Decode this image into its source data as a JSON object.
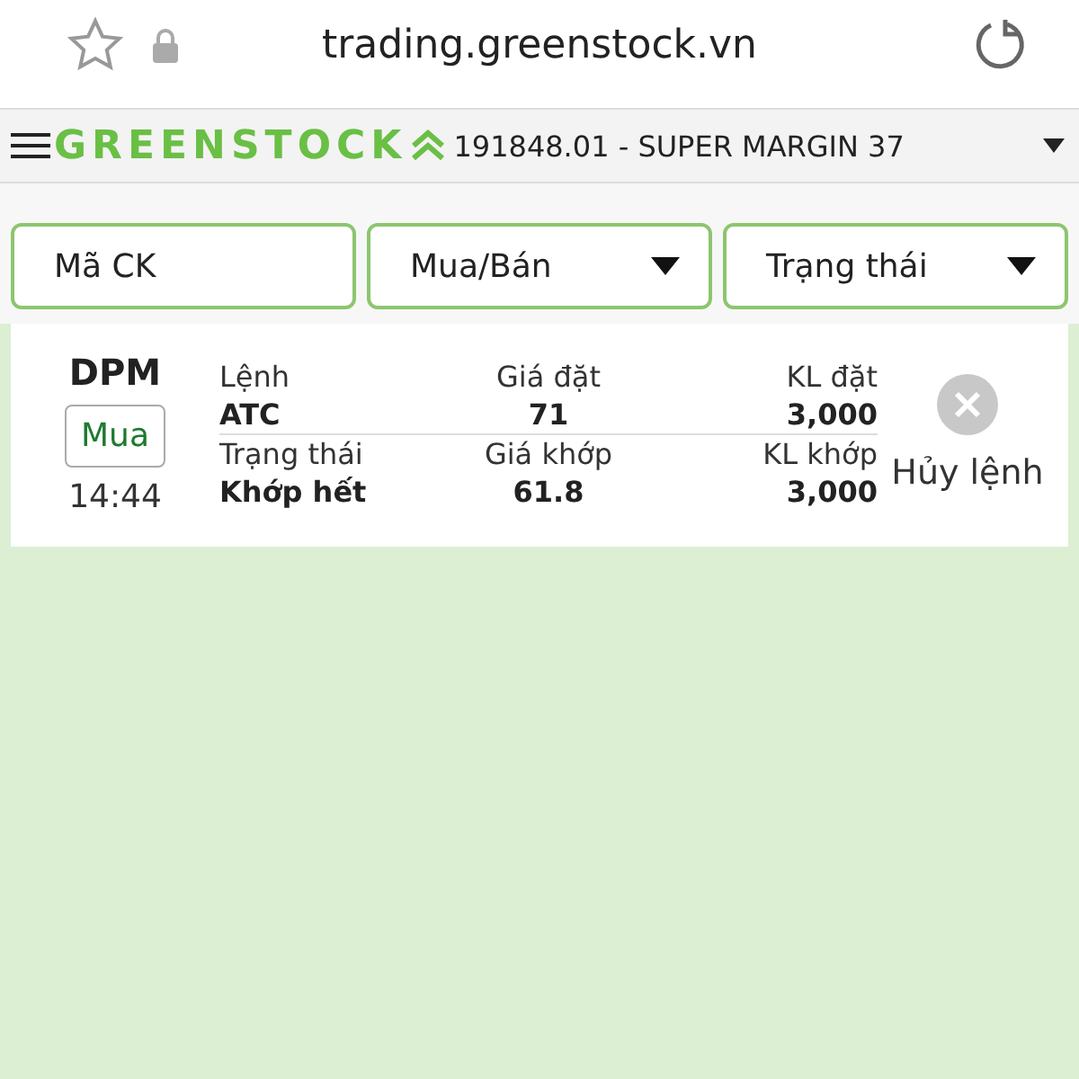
{
  "browser": {
    "url": "trading.greenstock.vn"
  },
  "header": {
    "logo": "GREENSTOCK",
    "account": "191848.01 - SUPER MARGIN 37"
  },
  "filters": [
    {
      "kind": "input",
      "placeholder": "Mã CK"
    },
    {
      "kind": "select",
      "label": "Mua/Bán"
    },
    {
      "kind": "select",
      "label": "Trạng thái"
    }
  ],
  "orders": [
    {
      "symbol": "DPM",
      "side": "Mua",
      "time": "14:44",
      "cancel_label": "Hủy lệnh",
      "cancel_disabled": true,
      "top": [
        {
          "label": "Lệnh",
          "value": "ATC"
        },
        {
          "label": "Giá đặt",
          "value": "71"
        },
        {
          "label": "KL đặt",
          "value": "3,000"
        }
      ],
      "bottom": [
        {
          "label": "Trạng thái",
          "value": "Khớp hết"
        },
        {
          "label": "Giá khớp",
          "value": "61.8"
        },
        {
          "label": "KL khớp",
          "value": "3,000"
        }
      ]
    }
  ]
}
